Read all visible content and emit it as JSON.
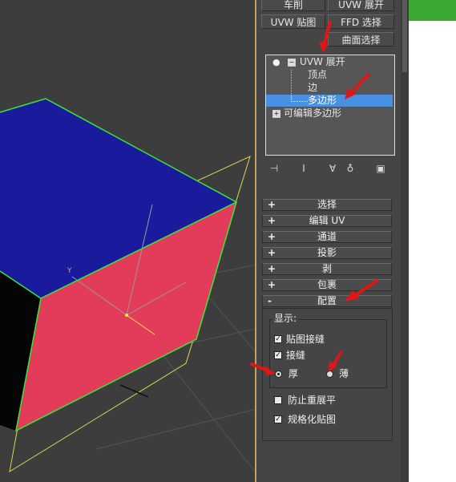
{
  "modifier_buttons": {
    "b1": "车削",
    "b2": "UVW 展开",
    "b3": "UVW 贴图",
    "b4": "FFD 选择",
    "b5": "曲面选择"
  },
  "stack": {
    "items": [
      {
        "label": "UVW 展开"
      },
      {
        "label": "顶点"
      },
      {
        "label": "边"
      },
      {
        "label": "多边形"
      },
      {
        "label": "可编辑多边形"
      }
    ],
    "selected_index": 3
  },
  "rollouts": {
    "items": [
      {
        "sign": "+",
        "label": "选择"
      },
      {
        "sign": "+",
        "label": "编辑 UV"
      },
      {
        "sign": "+",
        "label": "通道"
      },
      {
        "sign": "+",
        "label": "投影"
      },
      {
        "sign": "+",
        "label": "剥"
      },
      {
        "sign": "+",
        "label": "包裹"
      },
      {
        "sign": "-",
        "label": "配置"
      }
    ]
  },
  "config": {
    "display_label": "显示:",
    "show_map_seams": {
      "label": "贴图接缝",
      "checked": true
    },
    "seams": {
      "label": "接缝",
      "checked": true
    },
    "thick": {
      "label": "厚",
      "selected": true
    },
    "thin": {
      "label": "薄",
      "selected": false
    },
    "prevent_reflatten": {
      "label": "防止重展平",
      "checked": false
    },
    "normalize_map": {
      "label": "规格化贴图",
      "checked": true
    }
  },
  "colors": {
    "cube_top": "#1a1a9c",
    "cube_front": "#e33b5a",
    "edge_highlight": "#39e63a",
    "gizmo": "#d8d84a",
    "annotation_arrow": "#e01515",
    "selection": "#4a90e2"
  }
}
